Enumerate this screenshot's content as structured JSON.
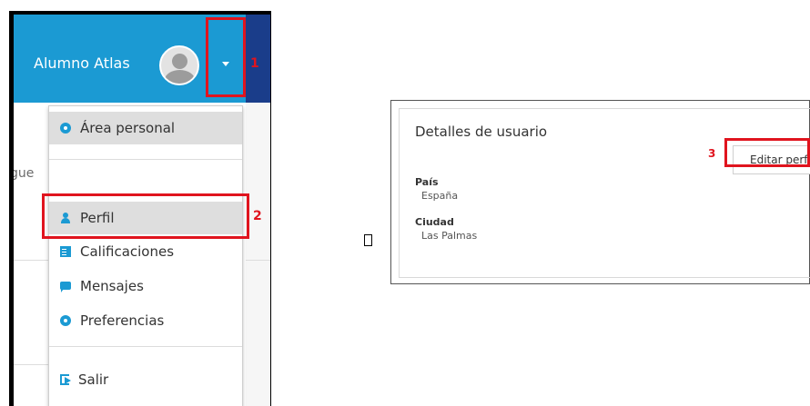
{
  "header": {
    "user_name": "Alumno Atlas"
  },
  "background_text": "gue",
  "menu": {
    "items": [
      {
        "label": "Área personal",
        "icon": "dashboard-icon"
      },
      {
        "label": "Perfil",
        "icon": "user-icon"
      },
      {
        "label": "Calificaciones",
        "icon": "grades-icon"
      },
      {
        "label": "Mensajes",
        "icon": "chat-icon"
      },
      {
        "label": "Preferencias",
        "icon": "gear-icon"
      },
      {
        "label": "Salir",
        "icon": "logout-icon"
      }
    ]
  },
  "annotations": {
    "step1": "1",
    "step2": "2",
    "step3": "3"
  },
  "separator_glyph": "",
  "profile": {
    "title": "Detalles de usuario",
    "edit_label": "Editar perfil",
    "country_label": "País",
    "country_value": "España",
    "city_label": "Ciudad",
    "city_value": "Las Palmas"
  },
  "colors": {
    "header_blue": "#1b9ad3",
    "dark_blue": "#1a3d8a",
    "annotation_red": "#e0141e",
    "highlight_gray": "#dedede"
  }
}
